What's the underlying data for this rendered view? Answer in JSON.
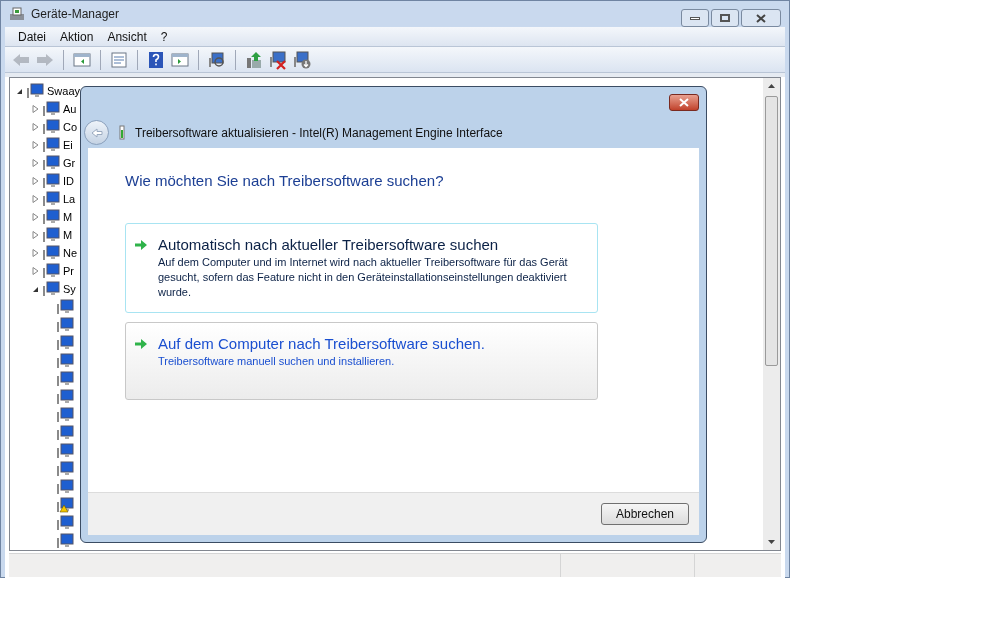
{
  "window": {
    "title": "Geräte-Manager"
  },
  "menu": [
    "Datei",
    "Aktion",
    "Ansicht",
    "?"
  ],
  "toolbar": [
    {
      "kind": "back",
      "disabled": true
    },
    {
      "kind": "forward",
      "disabled": true
    },
    {
      "kind": "sep"
    },
    {
      "kind": "panel"
    },
    {
      "kind": "sep"
    },
    {
      "kind": "props"
    },
    {
      "kind": "sep"
    },
    {
      "kind": "help"
    },
    {
      "kind": "panel2"
    },
    {
      "kind": "sep"
    },
    {
      "kind": "scan"
    },
    {
      "kind": "sep"
    },
    {
      "kind": "update"
    },
    {
      "kind": "uninstall"
    },
    {
      "kind": "disable"
    }
  ],
  "tree": {
    "label": "Swaay",
    "expanded": true,
    "children": [
      {
        "label": "Au",
        "expanded": false
      },
      {
        "label": "Co",
        "expanded": false
      },
      {
        "label": "Ei",
        "expanded": false
      },
      {
        "label": "Gr",
        "expanded": false
      },
      {
        "label": "ID",
        "expanded": false
      },
      {
        "label": "La",
        "expanded": false
      },
      {
        "label": "M",
        "expanded": false
      },
      {
        "label": "M",
        "expanded": false
      },
      {
        "label": "Ne",
        "expanded": false
      },
      {
        "label": "Pr",
        "expanded": false
      },
      {
        "label": "Sy",
        "expanded": true,
        "children": [
          {
            "warning": false
          },
          {
            "warning": false
          },
          {
            "warning": false
          },
          {
            "warning": false
          },
          {
            "warning": false
          },
          {
            "warning": false
          },
          {
            "warning": false
          },
          {
            "warning": false
          },
          {
            "warning": false
          },
          {
            "warning": false
          },
          {
            "warning": false
          },
          {
            "warning": true
          },
          {
            "warning": false
          },
          {
            "warning": false
          }
        ]
      }
    ]
  },
  "dialog": {
    "title": "Treibersoftware aktualisieren - Intel(R) Management Engine Interface",
    "heading": "Wie möchten Sie nach Treibersoftware suchen?",
    "options": [
      {
        "title": "Automatisch nach aktueller Treibersoftware suchen",
        "description": "Auf dem Computer und im Internet wird nach aktueller Treibersoftware für das Gerät gesucht, sofern das Feature nicht in den Geräteinstallationseinstellungen deaktiviert wurde.",
        "focused": true,
        "hovered": false
      },
      {
        "title": "Auf dem Computer nach Treibersoftware suchen.",
        "description": "Treibersoftware manuell suchen und installieren.",
        "focused": false,
        "hovered": true
      }
    ],
    "buttons": [
      "Abbrechen"
    ]
  }
}
